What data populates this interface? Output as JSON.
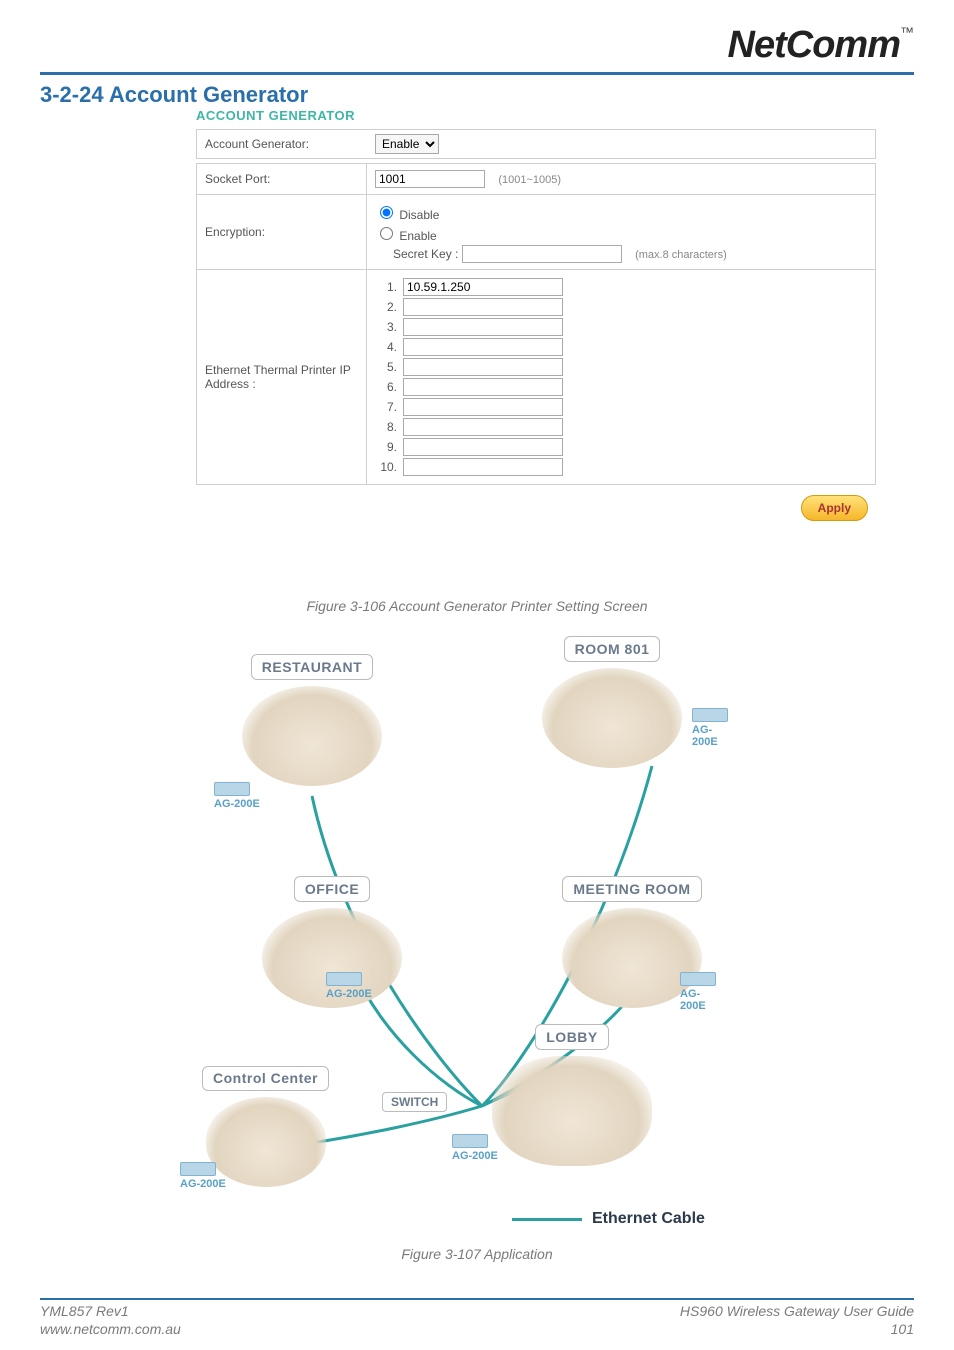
{
  "brand": {
    "name": "NetComm",
    "tm": "™"
  },
  "section_title": "3-2-24 Account Generator",
  "panel": {
    "title": "ACCOUNT GENERATOR",
    "toggle_label": "Account Generator:",
    "toggle_value": "Enable",
    "socket_port": {
      "label": "Socket Port:",
      "value": "1001",
      "hint": "(1001~1005)"
    },
    "encryption": {
      "label": "Encryption:",
      "disable": "Disable",
      "enable": "Enable",
      "secret_key_label": "Secret Key :",
      "secret_key_value": "",
      "secret_hint": "(max.8 characters)"
    },
    "printer": {
      "label": "Ethernet Thermal Printer IP Address :",
      "rows": [
        {
          "idx": "1.",
          "value": "10.59.1.250"
        },
        {
          "idx": "2.",
          "value": ""
        },
        {
          "idx": "3.",
          "value": ""
        },
        {
          "idx": "4.",
          "value": ""
        },
        {
          "idx": "5.",
          "value": ""
        },
        {
          "idx": "6.",
          "value": ""
        },
        {
          "idx": "7.",
          "value": ""
        },
        {
          "idx": "8.",
          "value": ""
        },
        {
          "idx": "9.",
          "value": ""
        },
        {
          "idx": "10.",
          "value": ""
        }
      ]
    },
    "apply": "Apply"
  },
  "captions": {
    "c1": "Figure 3-106 Account Generator Printer Setting Screen",
    "c2": "Figure 3-107 Application"
  },
  "illus": {
    "zones": {
      "restaurant": "RESTAURANT",
      "room801": "ROOM 801",
      "office": "OFFICE",
      "meeting": "MEETING ROOM",
      "lobby": "LOBBY",
      "control": "Control Center",
      "switch": "SWITCH"
    },
    "device": "AG-200E",
    "legend": "Ethernet Cable"
  },
  "footer": {
    "left1": "YML857 Rev1",
    "left2": "www.netcomm.com.au",
    "right1": "HS960 Wireless Gateway User Guide",
    "right2": "101"
  }
}
